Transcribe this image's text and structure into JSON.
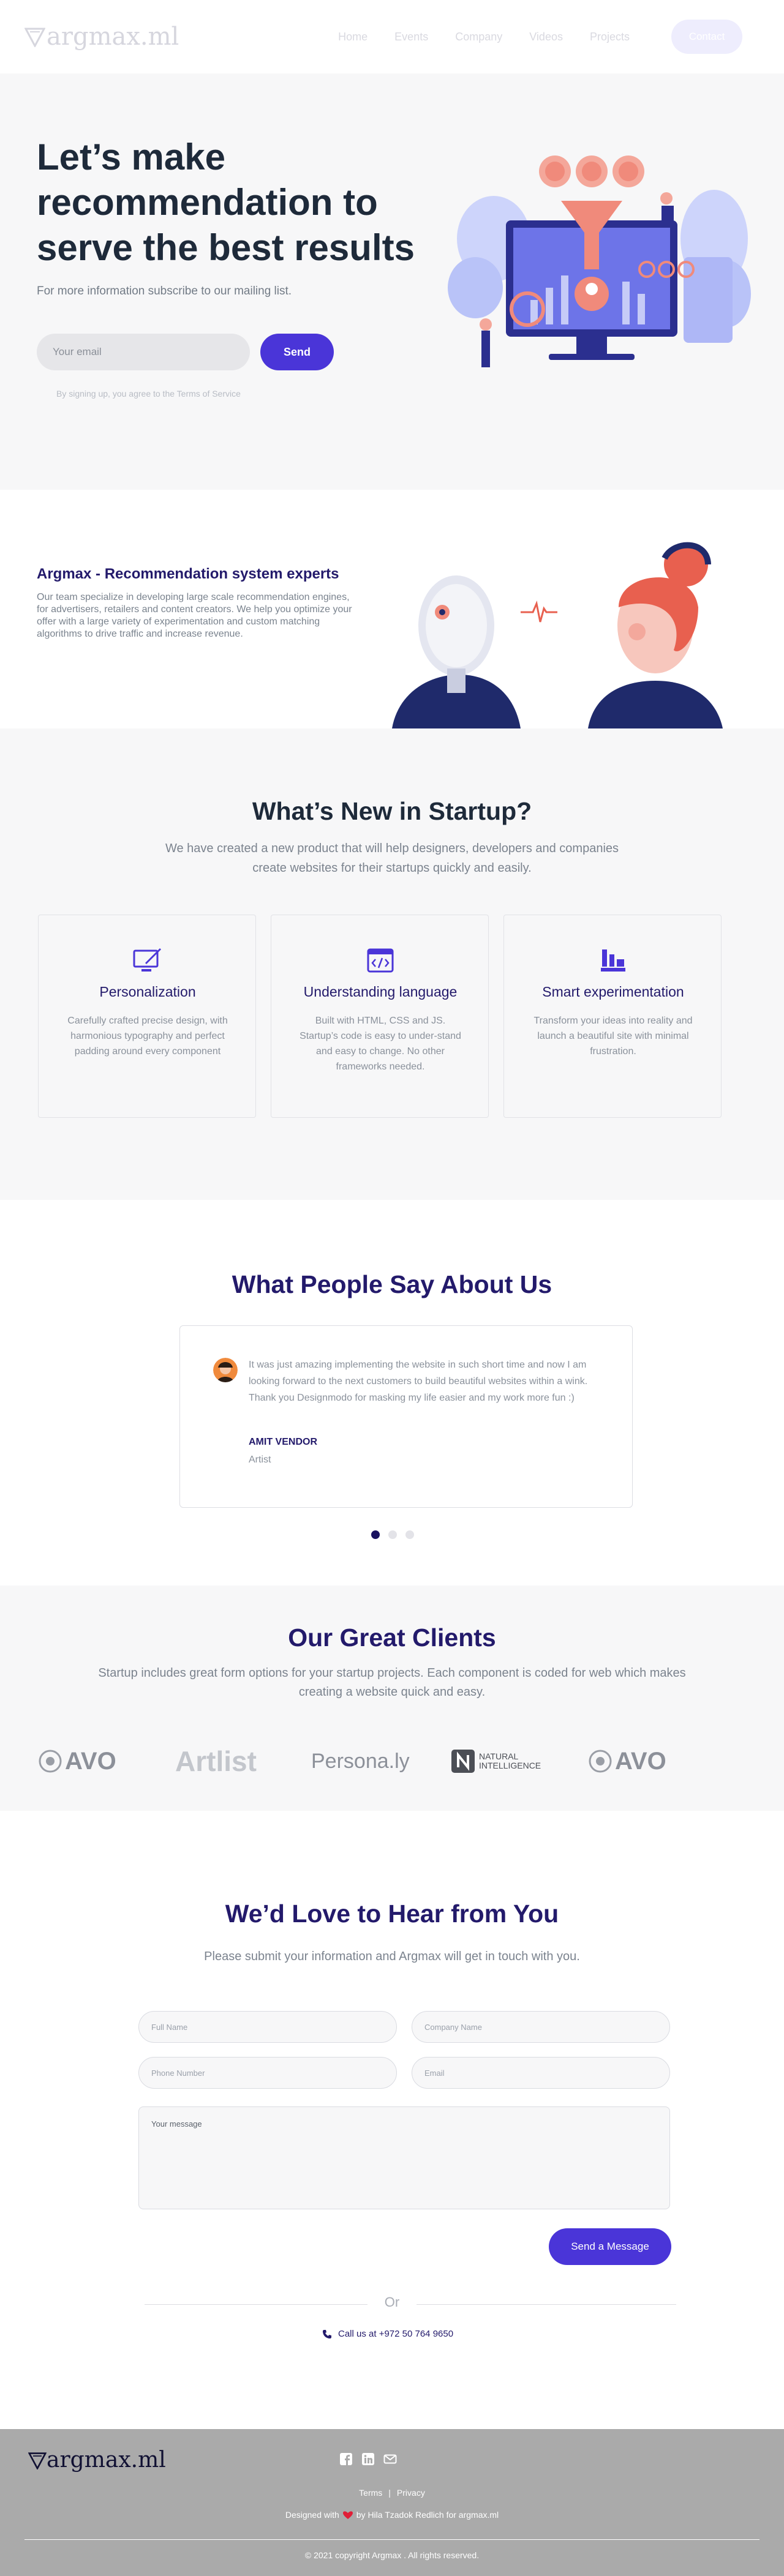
{
  "brand": {
    "logo_text": "argmax.ml",
    "accent": "#4a35d8",
    "navy": "#231a6b"
  },
  "nav": {
    "links": [
      "Home",
      "Events",
      "Company",
      "Videos",
      "Projects"
    ],
    "contact_label": "Contact"
  },
  "hero": {
    "title": "Let’s make recommendation to serve the best results",
    "subtitle": "For more information subscribe to our mailing list.",
    "email_placeholder": "Your email",
    "send_label": "Send",
    "terms": "By signing up, you agree to the Terms of Service"
  },
  "about": {
    "title": "Argmax - Recommendation system experts",
    "text": "Our team specialize in developing large scale recommendation engines, for advertisers, retailers and content creators. We help you optimize your offer with a large variety of experimentation and custom matching algorithms to drive traffic and increase revenue."
  },
  "whats_new": {
    "title": "What’s New in Startup?",
    "subtitle": "We have created a new product that will help designers, developers and companies create websites for their startups quickly and easily.",
    "cards": [
      {
        "icon": "monitor-pen-icon",
        "title": "Personalization",
        "text": "Carefully crafted precise design, with harmonious typography and perfect padding around every component"
      },
      {
        "icon": "code-window-icon",
        "title": "Understanding language",
        "text": "Built with HTML, CSS and JS. Startup’s code is easy to under-stand and easy to change. No other frameworks needed."
      },
      {
        "icon": "bars-chart-icon",
        "title": "Smart experimentation",
        "text": "Transform your ideas into reality and launch a beautiful site with minimal frustration."
      }
    ]
  },
  "testimonials": {
    "title": "What People Say About Us",
    "quote": "It was just amazing implementing the website in such short time and now I am looking forward to the next customers to build beautiful websites within a wink. Thank you Designmodo for masking my life easier and my work more fun :)",
    "author": "AMIT VENDOR",
    "role": "Artist",
    "active_slide": 1,
    "slide_count": 3
  },
  "clients": {
    "title": "Our Great Clients",
    "subtitle": "Startup includes great form options for your startup projects. Each component is coded for web which makes creating a website quick and easy.",
    "logos": [
      "AVO",
      "Artlist",
      "Persona.ly",
      "NATURAL INTELLIGENCE",
      "AVO"
    ]
  },
  "contact": {
    "title": "We’d Love to Hear from You",
    "subtitle": "Please submit your information and Argmax will get in touch with you.",
    "fields": {
      "full_name": "Full Name",
      "company": "Company Name",
      "phone": "Phone Number",
      "email": "Email",
      "message": "Your message"
    },
    "send_label": "Send a Message",
    "or": "Or",
    "phone_text": "Call us at +972 50 764 9650"
  },
  "footer": {
    "logo_text": "argmax.ml",
    "terms": "Terms",
    "separator": "|",
    "privacy": "Privacy",
    "designed_prefix": "Designed with",
    "designed_suffix": "by Hila Tzadok Redlich for argmax.ml",
    "copyright": "© 2021 copyright Argmax . All rights reserved."
  }
}
